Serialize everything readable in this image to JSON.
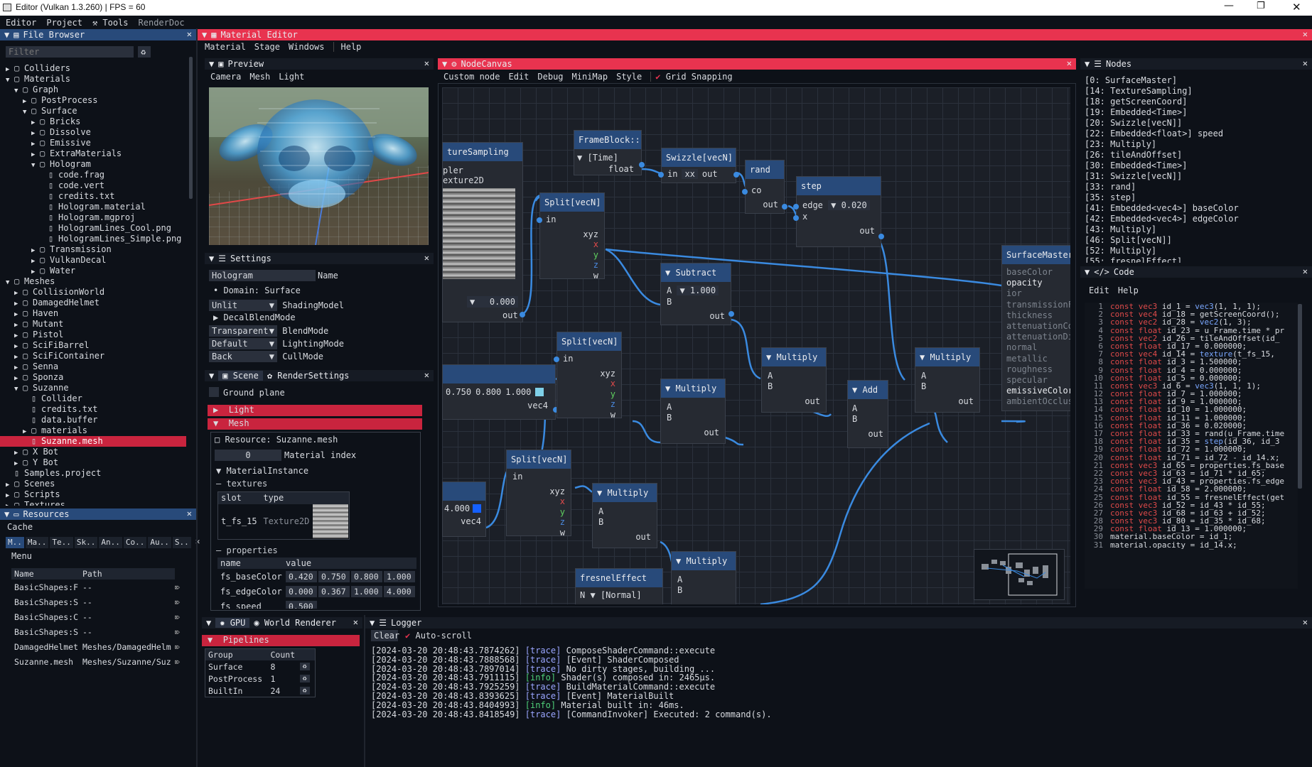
{
  "window": {
    "title": "Editor (Vulkan 1.3.260) | FPS = 60"
  },
  "menubar": [
    "Editor",
    "Project",
    "Tools",
    "RenderDoc"
  ],
  "file_browser": {
    "title": "File Browser",
    "filter_placeholder": "Filter",
    "items": [
      {
        "d": 1,
        "t": "Colliders",
        "k": "fc"
      },
      {
        "d": 1,
        "t": "Materials",
        "k": "fo"
      },
      {
        "d": 2,
        "t": "Graph",
        "k": "fo"
      },
      {
        "d": 3,
        "t": "PostProcess",
        "k": "fc"
      },
      {
        "d": 3,
        "t": "Surface",
        "k": "fo"
      },
      {
        "d": 4,
        "t": "Bricks",
        "k": "fc"
      },
      {
        "d": 4,
        "t": "Dissolve",
        "k": "fc"
      },
      {
        "d": 4,
        "t": "Emissive",
        "k": "fc"
      },
      {
        "d": 4,
        "t": "ExtraMaterials",
        "k": "fc"
      },
      {
        "d": 4,
        "t": "Hologram",
        "k": "fo"
      },
      {
        "d": 5,
        "t": "code.frag",
        "k": "f"
      },
      {
        "d": 5,
        "t": "code.vert",
        "k": "f"
      },
      {
        "d": 5,
        "t": "credits.txt",
        "k": "f"
      },
      {
        "d": 5,
        "t": "Hologram.material",
        "k": "f"
      },
      {
        "d": 5,
        "t": "Hologram.mgproj",
        "k": "f"
      },
      {
        "d": 5,
        "t": "HologramLines_Cool.png",
        "k": "f"
      },
      {
        "d": 5,
        "t": "HologramLines_Simple.png",
        "k": "f"
      },
      {
        "d": 4,
        "t": "Transmission",
        "k": "fc"
      },
      {
        "d": 4,
        "t": "VulkanDecal",
        "k": "fc"
      },
      {
        "d": 4,
        "t": "Water",
        "k": "fc"
      },
      {
        "d": 1,
        "t": "Meshes",
        "k": "fo"
      },
      {
        "d": 2,
        "t": "CollisionWorld",
        "k": "fc"
      },
      {
        "d": 2,
        "t": "DamagedHelmet",
        "k": "fc"
      },
      {
        "d": 2,
        "t": "Haven",
        "k": "fc"
      },
      {
        "d": 2,
        "t": "Mutant",
        "k": "fc"
      },
      {
        "d": 2,
        "t": "Pistol",
        "k": "fc"
      },
      {
        "d": 2,
        "t": "SciFiBarrel",
        "k": "fc"
      },
      {
        "d": 2,
        "t": "SciFiContainer",
        "k": "fc"
      },
      {
        "d": 2,
        "t": "Senna",
        "k": "fc"
      },
      {
        "d": 2,
        "t": "Sponza",
        "k": "fc"
      },
      {
        "d": 2,
        "t": "Suzanne",
        "k": "fo"
      },
      {
        "d": 3,
        "t": "Collider",
        "k": "f"
      },
      {
        "d": 3,
        "t": "credits.txt",
        "k": "f"
      },
      {
        "d": 3,
        "t": "data.buffer",
        "k": "f"
      },
      {
        "d": 3,
        "t": "materials",
        "k": "fc"
      },
      {
        "d": 3,
        "t": "Suzanne.mesh",
        "k": "f",
        "sel": true
      },
      {
        "d": 2,
        "t": "X Bot",
        "k": "fc"
      },
      {
        "d": 2,
        "t": "Y Bot",
        "k": "fc"
      },
      {
        "d": 1,
        "t": "Samples.project",
        "k": "f"
      },
      {
        "d": 1,
        "t": "Scenes",
        "k": "fc"
      },
      {
        "d": 1,
        "t": "Scripts",
        "k": "fc"
      },
      {
        "d": 1,
        "t": "Textures",
        "k": "fc"
      }
    ]
  },
  "resources": {
    "title": "Resources",
    "cache": "Cache",
    "tabs": [
      "M..",
      "Ma..",
      "Te..",
      "Sk..",
      "An..",
      "Co..",
      "Au..",
      "S.."
    ],
    "menu": "Menu",
    "columns": [
      "Name",
      "Path"
    ],
    "rows": [
      [
        "BasicShapes:F",
        "--"
      ],
      [
        "BasicShapes:S",
        "--"
      ],
      [
        "BasicShapes:C",
        "--"
      ],
      [
        "BasicShapes:S",
        "--"
      ],
      [
        "DamagedHelmet",
        "Meshes/DamagedHelm"
      ],
      [
        "Suzanne.mesh",
        "Meshes/Suzanne/Suz"
      ]
    ]
  },
  "material_editor": {
    "title": "Material Editor",
    "menu": [
      "Material",
      "Stage",
      "Windows",
      "Help"
    ]
  },
  "preview": {
    "title": "Preview",
    "menu": [
      "Camera",
      "Mesh",
      "Light"
    ]
  },
  "settings": {
    "title": "Settings",
    "name_value": "Hologram",
    "name_label": "Name",
    "domain": "Domain: Surface",
    "rows": [
      {
        "v": "Unlit",
        "l": "ShadingModel"
      },
      {
        "v": "Transparent",
        "l": "BlendMode"
      },
      {
        "v": "Default",
        "l": "LightingMode"
      },
      {
        "v": "Back",
        "l": "CullMode"
      }
    ],
    "decal": "DecalBlendMode"
  },
  "scene": {
    "tabs": [
      "Scene",
      "RenderSettings"
    ],
    "ground": "Ground plane",
    "light": "Light",
    "mesh": "Mesh",
    "resource": "Resource: Suzanne.mesh",
    "material_index": "0",
    "material_index_label": "Material index",
    "material_instance": "MaterialInstance",
    "textures": "textures",
    "tex_cols": [
      "slot",
      "type"
    ],
    "tex_row": [
      "t_fs_15",
      "Texture2D"
    ],
    "properties": "properties",
    "prop_cols": [
      "name",
      "value"
    ],
    "props": [
      {
        "n": "fs_baseColor",
        "v": [
          "0.420",
          "0.750",
          "0.800",
          "1.000"
        ]
      },
      {
        "n": "fs_edgeColor",
        "v": [
          "0.000",
          "0.367",
          "1.000",
          "4.000"
        ]
      },
      {
        "n": "fs_speed",
        "v": [
          "0.500"
        ]
      }
    ]
  },
  "gpu": {
    "tabs": [
      "GPU",
      "World Renderer"
    ],
    "pipelines": "Pipelines",
    "cols": [
      "Group",
      "Count"
    ],
    "rows": [
      [
        "Surface",
        "8"
      ],
      [
        "PostProcess",
        "1"
      ],
      [
        "BuiltIn",
        "24"
      ]
    ]
  },
  "nodecanvas": {
    "title": "NodeCanvas",
    "menu": [
      "Custom node",
      "Edit",
      "Debug",
      "MiniMap",
      "Style"
    ],
    "grid_snapping": "Grid Snapping",
    "nodes": {
      "texsamp": {
        "title": "tureSampling",
        "rows": [
          "pler",
          "exture2D"
        ],
        "value": "0.000",
        "out": "out"
      },
      "frameblock": {
        "title": "FrameBlock::",
        "time": "[Time]",
        "float": "float"
      },
      "swizzle1": {
        "title": "Swizzle[vecN]",
        "in": "in",
        "xx": "xx",
        "out": "out"
      },
      "rand": {
        "title": "rand",
        "co": "co",
        "out": "out"
      },
      "step": {
        "title": "step",
        "edge": "edge",
        "edge_v": "0.020",
        "x": "x",
        "out": "out"
      },
      "split1": {
        "title": "Split[vecN]",
        "in": "in",
        "xyz": "xyz",
        "x": "x",
        "y": "y",
        "z": "z",
        "w": "w"
      },
      "subtract": {
        "title": "Subtract",
        "a": "A",
        "a_v": "1.000",
        "b": "B",
        "out": "out"
      },
      "surfmaster": {
        "title": "SurfaceMaster",
        "inputs": [
          "baseColor",
          "opacity",
          "ior",
          "transmissionF",
          "thickness",
          "attenuationCo",
          "attenuationDi",
          "normal",
          "metallic",
          "roughness",
          "specular",
          "emissiveColor",
          "ambientOcclus"
        ]
      },
      "split2": {
        "title": "Split[vecN]",
        "in": "in",
        "xyz": "xyz",
        "x": "x",
        "y": "y",
        "z": "z",
        "w": "w"
      },
      "vec4a": {
        "vals": [
          "0.750",
          "0.800",
          "1.000"
        ],
        "out": "vec4"
      },
      "multiply1": {
        "title": "Multiply",
        "a": "A",
        "b": "B",
        "out": "out"
      },
      "multiply2": {
        "title": "Multiply",
        "a": "A",
        "b": "B",
        "out": "out"
      },
      "add": {
        "title": "Add",
        "a": "A",
        "b": "B",
        "out": "out"
      },
      "multiply3": {
        "title": "Multiply",
        "a": "A",
        "b": "B",
        "out": "out"
      },
      "split3": {
        "title": "Split[vecN]",
        "in": "in",
        "xyz": "xyz",
        "x": "x",
        "y": "y",
        "z": "z",
        "w": "w"
      },
      "vec4b": {
        "val": "4.000",
        "out": "vec4"
      },
      "multiply4": {
        "title": "Multiply",
        "a": "A",
        "b": "B",
        "out": "out"
      },
      "multiply5": {
        "title": "Multiply",
        "a": "A",
        "b": "B"
      },
      "fresnel": {
        "title": "fresnelEffect",
        "n": "N",
        "normal": "[Normal]"
      }
    }
  },
  "nodes_panel": {
    "title": "Nodes",
    "items": [
      "[0: SurfaceMaster]",
      "[14: TextureSampling]",
      "[18: getScreenCoord]",
      "[19: Embedded<Time>]",
      "[20: Swizzle[vecN]]",
      "[22: Embedded<float>] speed",
      "[23: Multiply]",
      "[26: tileAndOffset]",
      "[30: Embedded<Time>]",
      "[31: Swizzle[vecN]]",
      "[33: rand]",
      "[35: step]",
      "[41: Embedded<vec4>] baseColor",
      "[42: Embedded<vec4>] edgeColor",
      "[43: Multiply]",
      "[46: Split[vecN]]",
      "[52: Multiply]",
      "[55: fresnelEffect]"
    ]
  },
  "code_panel": {
    "title": "Code",
    "menu": [
      "Edit",
      "Help"
    ],
    "lines": [
      [
        "const ",
        "vec3",
        " id_1 = ",
        "vec3",
        "(1, 1, 1);"
      ],
      [
        "const ",
        "vec4",
        " id_18 = getScreenCoord();",
        "",
        ""
      ],
      [
        "const ",
        "vec2",
        " id_28 = ",
        "vec2",
        "(1, 3);"
      ],
      [
        "const ",
        "float",
        " id_23 = u_Frame.time * pr",
        "",
        ""
      ],
      [
        "const ",
        "vec2",
        " id_26 = tileAndOffset(id_",
        "",
        ""
      ],
      [
        "const ",
        "float",
        " id_17 = 0.000000;",
        "",
        ""
      ],
      [
        "const ",
        "vec4",
        " id_14 = ",
        "texture",
        "(t_fs_15, "
      ],
      [
        "const ",
        "float",
        " id_3 = 1.500000;",
        "",
        ""
      ],
      [
        "const ",
        "float",
        " id_4 = 0.000000;",
        "",
        ""
      ],
      [
        "const ",
        "float",
        " id_5 = 0.000000;",
        "",
        ""
      ],
      [
        "const ",
        "vec3",
        " id_6 = ",
        "vec3",
        "(1, 1, 1);"
      ],
      [
        "const ",
        "float",
        " id_7 = 1.000000;",
        "",
        ""
      ],
      [
        "const ",
        "float",
        " id_9 = 1.000000;",
        "",
        ""
      ],
      [
        "const ",
        "float",
        " id_10 = 1.000000;",
        "",
        ""
      ],
      [
        "const ",
        "float",
        " id_11 = 1.000000;",
        "",
        ""
      ],
      [
        "const ",
        "float",
        " id_36 = 0.020000;",
        "",
        ""
      ],
      [
        "const ",
        "float",
        " id_33 = rand(u_Frame.time",
        "",
        ""
      ],
      [
        "const ",
        "float",
        " id_35 = ",
        "step",
        "(id_36, id_3"
      ],
      [
        "const ",
        "float",
        " id_72 = 1.000000;",
        "",
        ""
      ],
      [
        "const ",
        "float",
        " id_71 = id_72 - id_14.x;",
        "",
        ""
      ],
      [
        "const ",
        "vec3",
        " id_65 = properties.fs_base",
        "",
        ""
      ],
      [
        "const ",
        "vec3",
        " id_63 = id_71 * id_65;",
        "",
        ""
      ],
      [
        "const ",
        "vec3",
        " id_43 = properties.fs_edge",
        "",
        ""
      ],
      [
        "const ",
        "float",
        " id_58 = 2.000000;",
        "",
        ""
      ],
      [
        "const ",
        "float",
        " id_55 = fresnelEffect(get",
        "",
        ""
      ],
      [
        "const ",
        "vec3",
        " id_52 = id_43 * id_55;",
        "",
        ""
      ],
      [
        "const ",
        "vec3",
        " id_68 = id_63 + id_52;",
        "",
        ""
      ],
      [
        "const ",
        "vec3",
        " id_80 = id_35 * id_68;",
        "",
        ""
      ],
      [
        "const ",
        "float",
        " id_13 = 1.000000;",
        "",
        ""
      ],
      [
        "",
        "material",
        "",
        "",
        "",
        "material.baseColor = id_1;"
      ],
      [
        "",
        "material",
        "",
        "",
        "",
        "material.opacity = id_14.x;"
      ]
    ]
  },
  "logger": {
    "title": "Logger",
    "clear": "Clear",
    "autoscroll": "Auto-scroll",
    "lines": [
      [
        "[2024-03-20 20:48:43.7874262]",
        "[trace]",
        "ComposeShaderCommand::execute"
      ],
      [
        "[2024-03-20 20:48:43.7888568]",
        "[trace]",
        "[Event] ShaderComposed"
      ],
      [
        "[2024-03-20 20:48:43.7897014]",
        "[trace]",
        "No dirty stages, building ..."
      ],
      [
        "[2024-03-20 20:48:43.7911115]",
        "[info]",
        "Shader(s) composed in: 2465µs."
      ],
      [
        "[2024-03-20 20:48:43.7925259]",
        "[trace]",
        "BuildMaterialCommand::execute"
      ],
      [
        "[2024-03-20 20:48:43.8393625]",
        "[trace]",
        "[Event] MaterialBuilt"
      ],
      [
        "[2024-03-20 20:48:43.8404993]",
        "[info]",
        "Material built in: 46ms."
      ],
      [
        "[2024-03-20 20:48:43.8418549]",
        "[trace]",
        "[CommandInvoker] Executed: 2 command(s)."
      ]
    ]
  },
  "colors": {
    "accent_red": "#e8334f",
    "accent_blue": "#284a7a",
    "wire": "#3a8ae0",
    "trace": "#9aa6ff",
    "info": "#4fd17a"
  }
}
